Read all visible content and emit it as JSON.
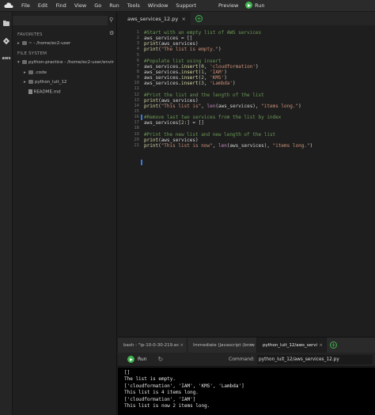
{
  "menubar": {
    "items": [
      "File",
      "Edit",
      "Find",
      "View",
      "Go",
      "Run",
      "Tools",
      "Window",
      "Support"
    ],
    "preview": "Preview",
    "run": "Run"
  },
  "sidebar": {
    "favorites": "FAVORITES",
    "fav_item": "~ - /home/ec2-user",
    "filesystem": "FILE SYSTEM",
    "root": "python-practice - /home/ec2-user/envir",
    "items": [
      ".code",
      "python_luit_12",
      "README.md"
    ]
  },
  "editor": {
    "tab": "aws_services_12.py",
    "lines": [
      [
        {
          "t": "#Start with an empty list of AWS services",
          "c": "cmt"
        }
      ],
      [
        {
          "t": "aws_services = []"
        }
      ],
      [
        {
          "t": "print",
          "c": "kw"
        },
        {
          "t": "(aws_services)"
        }
      ],
      [
        {
          "t": "print",
          "c": "kw"
        },
        {
          "t": "("
        },
        {
          "t": "\"The list is empty.\"",
          "c": "str"
        },
        {
          "t": ")"
        }
      ],
      [
        {
          "t": ""
        }
      ],
      [
        {
          "t": "#Populate list using insert",
          "c": "cmt"
        }
      ],
      [
        {
          "t": "aws_services."
        },
        {
          "t": "insert",
          "c": "kw"
        },
        {
          "t": "("
        },
        {
          "t": "0",
          "c": "num"
        },
        {
          "t": ", "
        },
        {
          "t": "'cloudformation'",
          "c": "str"
        },
        {
          "t": ")"
        }
      ],
      [
        {
          "t": "aws_services."
        },
        {
          "t": "insert",
          "c": "kw"
        },
        {
          "t": "("
        },
        {
          "t": "1",
          "c": "num"
        },
        {
          "t": ", "
        },
        {
          "t": "'IAM'",
          "c": "str"
        },
        {
          "t": ")"
        }
      ],
      [
        {
          "t": "aws_services."
        },
        {
          "t": "insert",
          "c": "kw"
        },
        {
          "t": "("
        },
        {
          "t": "2",
          "c": "num"
        },
        {
          "t": ", "
        },
        {
          "t": "'KMS'",
          "c": "str"
        },
        {
          "t": ")"
        }
      ],
      [
        {
          "t": "aws_services."
        },
        {
          "t": "insert",
          "c": "kw"
        },
        {
          "t": "("
        },
        {
          "t": "3",
          "c": "num"
        },
        {
          "t": ", "
        },
        {
          "t": "'Lambda'",
          "c": "str"
        },
        {
          "t": ")"
        }
      ],
      [
        {
          "t": ""
        }
      ],
      [
        {
          "t": "#Print the list and the length of the list",
          "c": "cmt"
        }
      ],
      [
        {
          "t": "print",
          "c": "kw"
        },
        {
          "t": "(aws_services)"
        }
      ],
      [
        {
          "t": "print",
          "c": "kw"
        },
        {
          "t": "("
        },
        {
          "t": "\"This list is\"",
          "c": "str"
        },
        {
          "t": ", "
        },
        {
          "t": "len",
          "c": "bi"
        },
        {
          "t": "(aws_services), "
        },
        {
          "t": "\"items long.\"",
          "c": "str"
        },
        {
          "t": ")"
        }
      ],
      [
        {
          "t": ""
        }
      ],
      [
        {
          "t": "#Remove last two services from the list by index",
          "c": "cmt"
        }
      ],
      [
        {
          "t": "aws_services["
        },
        {
          "t": "2",
          "c": "num"
        },
        {
          "t": ":] = []"
        }
      ],
      [
        {
          "t": ""
        }
      ],
      [
        {
          "t": "#Print the new list and new length of the list",
          "c": "cmt"
        }
      ],
      [
        {
          "t": "print",
          "c": "kw"
        },
        {
          "t": "(aws_services)"
        }
      ],
      [
        {
          "t": "print",
          "c": "kw"
        },
        {
          "t": "("
        },
        {
          "t": "\"This list is now\"",
          "c": "str"
        },
        {
          "t": ", "
        },
        {
          "t": "len",
          "c": "bi"
        },
        {
          "t": "(aws_services), "
        },
        {
          "t": "\"items long.\"",
          "c": "str"
        },
        {
          "t": ")"
        }
      ]
    ],
    "line_numbers": [
      "1",
      "2",
      "3",
      "4",
      "5",
      "6",
      "7",
      "8",
      "9",
      "10",
      "11",
      "12",
      "13",
      "14",
      "15",
      "16",
      "17",
      "18",
      "19",
      "20",
      "21"
    ]
  },
  "bottom": {
    "tabs": [
      "bash - \"ip-10-0-30-219.ec",
      "Immediate (Javascript (brow",
      "python_luit_12/aws_service"
    ],
    "run": "Run",
    "command_label": "Command:",
    "command": "python_luit_12/aws_services_12.py",
    "output": [
      "[]",
      "The list is empty.",
      "['cloudformation', 'IAM', 'KMS', 'Lambda']",
      "This list is 4 items long.",
      "['cloudformation', 'IAM']",
      "This list is now 2 items long."
    ]
  },
  "colors": {
    "accent": "#3fb34f",
    "background": "#1e1e1e"
  }
}
